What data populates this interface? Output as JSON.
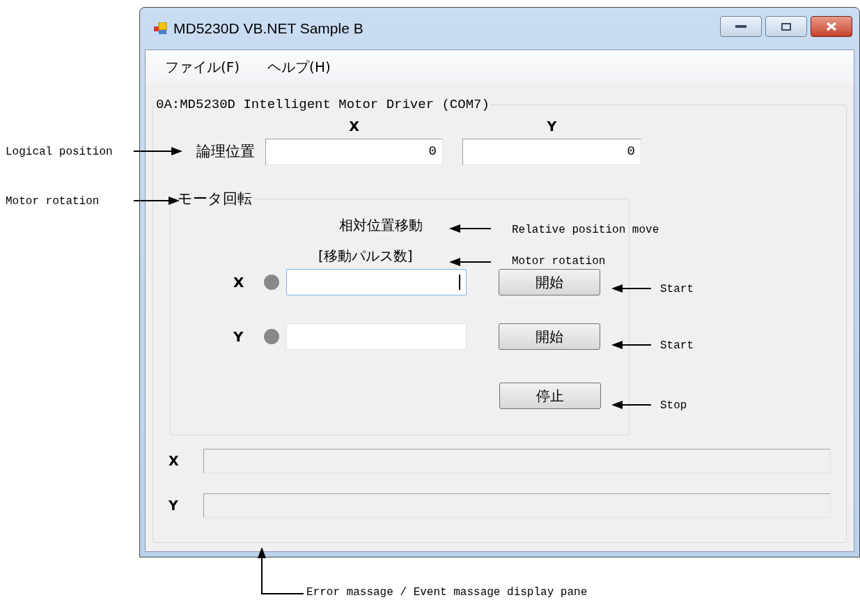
{
  "window": {
    "title": "MD5230D VB.NET Sample B"
  },
  "menu": [
    "ファイル(F)",
    "ヘルプ(H)"
  ],
  "group": {
    "title": "0A:MD5230D Intelligent Motor Driver (COM7)",
    "column_headers": [
      "X",
      "Y"
    ],
    "logical_position": {
      "label": "論理位置",
      "values": [
        "0",
        "0"
      ]
    },
    "motor_rotation": {
      "title": "モータ回転",
      "heading": "相対位置移動",
      "subheading": "[移動パルス数]",
      "axes": [
        {
          "label": "X",
          "focused": true,
          "button": "開始"
        },
        {
          "label": "Y",
          "focused": false,
          "button": "開始"
        }
      ],
      "stop_button": "停止"
    },
    "status_rows": [
      {
        "label": "X"
      },
      {
        "label": "Y"
      }
    ]
  },
  "annotations": [
    {
      "text": "Logical position",
      "kind": "right"
    },
    {
      "text": "Motor rotation",
      "kind": "right"
    },
    {
      "text": "Relative position move",
      "kind": "left"
    },
    {
      "text": "Motor rotation",
      "kind": "left"
    },
    {
      "text": "Start",
      "kind": "left"
    },
    {
      "text": "Start",
      "kind": "left"
    },
    {
      "text": "Stop",
      "kind": "left"
    },
    {
      "text": "Error massage / Event massage display pane",
      "kind": "up"
    }
  ]
}
